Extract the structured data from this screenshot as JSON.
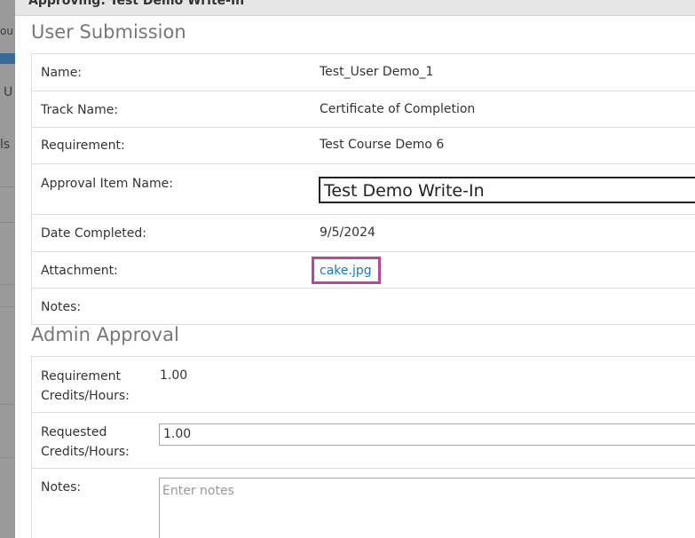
{
  "background": {
    "peek_text_1": "ou",
    "peek_text_2": "U",
    "peek_text_3": "ls"
  },
  "modal": {
    "header_title": "Approving: Test Demo Write-In"
  },
  "user_submission": {
    "title": "User Submission",
    "name_label": "Name:",
    "name_value": "Test_User Demo_1",
    "track_label": "Track Name:",
    "track_value": "Certificate of Completion",
    "requirement_label": "Requirement:",
    "requirement_value": "Test Course Demo 6",
    "approval_item_label": "Approval Item Name:",
    "approval_item_value": "Test Demo Write-In",
    "date_label": "Date Completed:",
    "date_value": "9/5/2024",
    "attachment_label": "Attachment:",
    "attachment_value": "cake.jpg",
    "notes_label": "Notes:"
  },
  "admin_approval": {
    "title": "Admin Approval",
    "req_credits_label_1": "Requirement",
    "req_credits_label_2": "Credits/Hours:",
    "req_credits_value": "1.00",
    "requested_label_1": "Requested",
    "requested_label_2": "Credits/Hours:",
    "requested_value": "1.00",
    "notes_label": "Notes:",
    "notes_placeholder": "Enter notes"
  },
  "colors": {
    "highlight": "#b8489a",
    "link": "#1a7bbf"
  }
}
